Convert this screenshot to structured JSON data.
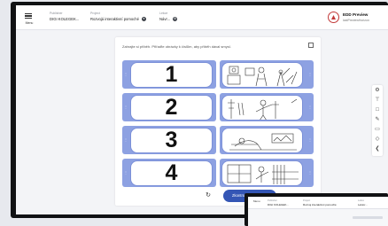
{
  "header": {
    "menu_label": "Menu",
    "publisher_label": "Publisher",
    "publisher_value": "DIGI KOLEGEK...",
    "project_label": "Project",
    "project_value": "Rozvojá interaktivní pomoché",
    "lesson_label": "Lekce",
    "lesson_value": "Návr...",
    "brand_title": "EDD Preview",
    "brand_sub": "lastPreviewHorizon"
  },
  "exercise": {
    "instruction": "Zahrajte si příběh. Přiřaďte obrázky k číslům, aby příběh dával smysl.",
    "numbers": [
      "1",
      "2",
      "3",
      "4"
    ],
    "check_label": "Zkontrolovat"
  },
  "toolbar": {
    "icons": [
      "gear-icon",
      "pin-icon",
      "copy-icon",
      "pencil-icon",
      "comment-icon",
      "bookmark-icon",
      "share-icon"
    ]
  },
  "device2": {
    "menu_label": "Menu",
    "publisher_label": "Publisher",
    "publisher_value": "DIGI KOLEGEK...",
    "project_label": "Project",
    "project_value": "Rozvoj interaktivní pomoché",
    "lesson_label": "Lekce",
    "lesson_value": "Lektor..."
  }
}
